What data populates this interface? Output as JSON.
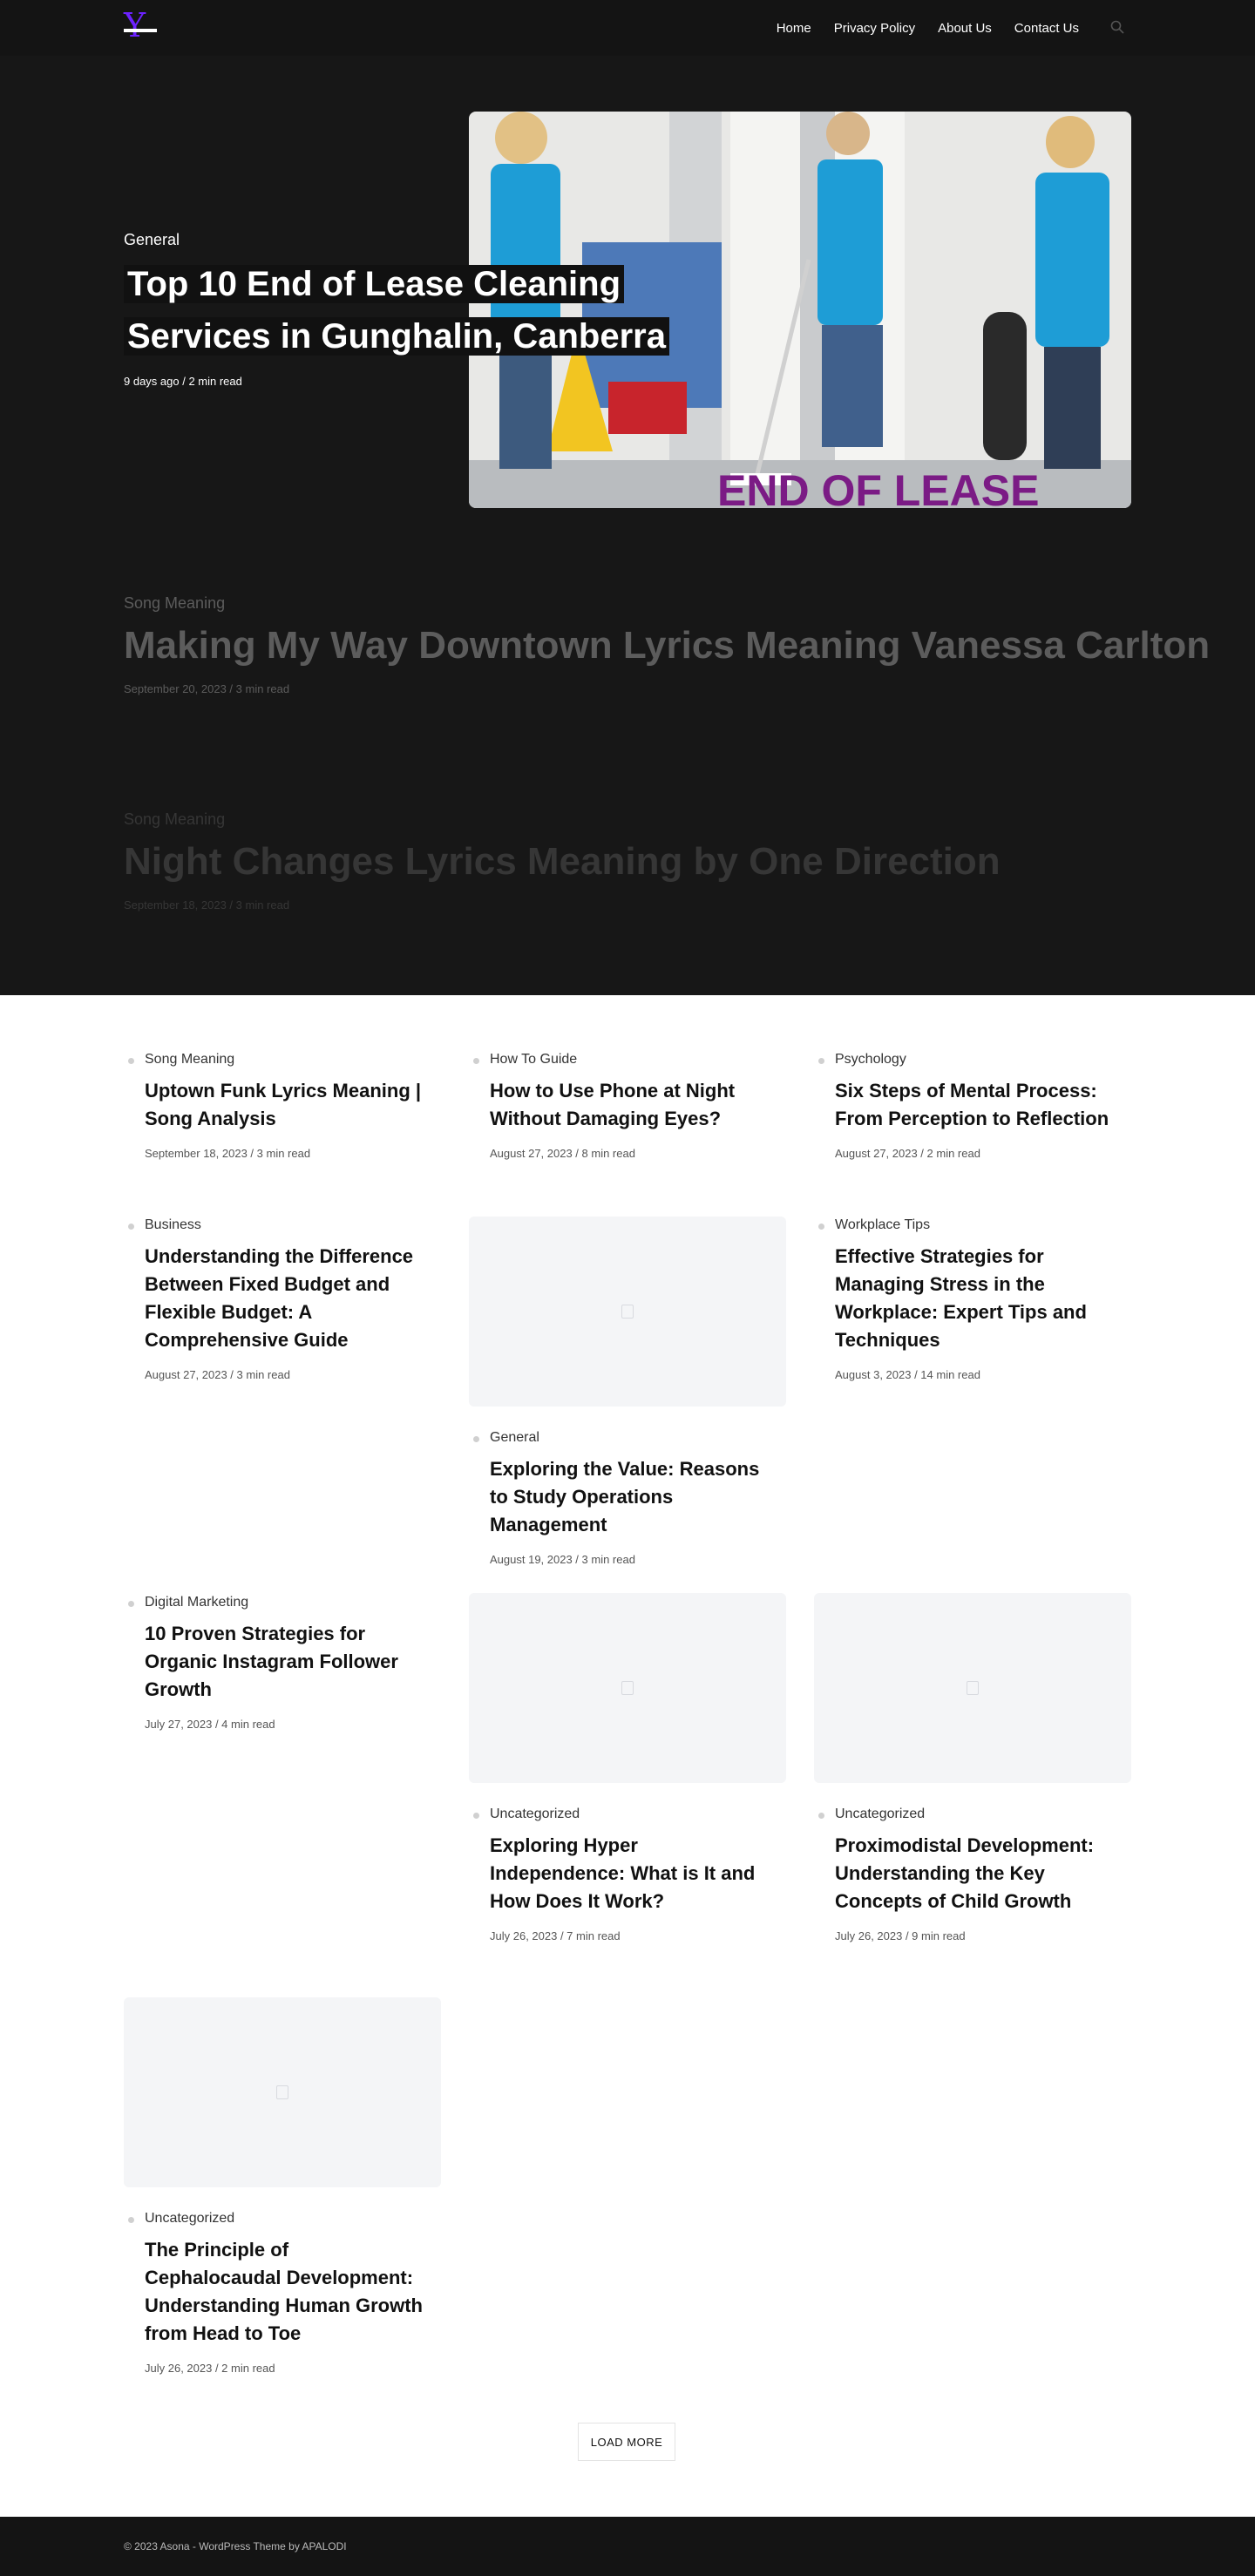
{
  "header": {
    "logo_letter": "Y",
    "nav": [
      "Home",
      "Privacy Policy",
      "About Us",
      "Contact Us"
    ]
  },
  "featured": {
    "category": "General",
    "title": "Top 10 End of Lease Cleaning Services in Gunghalin, Canberra",
    "meta": "9 days ago / 2 min read",
    "image_text": "END OF LEASE"
  },
  "hero_posts": [
    {
      "category": "Song Meaning",
      "title": "Making My Way Downtown Lyrics Meaning Vanessa Carlton",
      "meta": "September 20, 2023 / 3 min read"
    },
    {
      "category": "Song Meaning",
      "title": "Night Changes Lyrics Meaning by One Direction",
      "meta": "September 18, 2023 / 3 min read"
    }
  ],
  "posts": [
    {
      "category": "Song Meaning",
      "title": "Uptown Funk Lyrics Meaning | Song Analysis",
      "meta": "September 18, 2023 / 3 min read"
    },
    {
      "category": "How To Guide",
      "title": "How to Use Phone at Night Without Damaging Eyes?",
      "meta": "August 27, 2023 / 8 min read"
    },
    {
      "category": "Psychology",
      "title": "Six Steps of Mental Process: From Perception to Reflection",
      "meta": "August 27, 2023 / 2 min read"
    },
    {
      "category": "Business",
      "title": "Understanding the Difference Between Fixed Budget and Flexible Budget: A Comprehensive Guide",
      "meta": "August 27, 2023 / 3 min read"
    },
    {
      "category": "General",
      "title": "Exploring the Value: Reasons to Study Operations Management",
      "meta": "August 19, 2023 / 3 min read"
    },
    {
      "category": "Workplace Tips",
      "title": "Effective Strategies for Managing Stress in the Workplace: Expert Tips and Techniques",
      "meta": "August 3, 2023 / 14 min read"
    },
    {
      "category": "Digital Marketing",
      "title": "10 Proven Strategies for Organic Instagram Follower Growth",
      "meta": "July 27, 2023 / 4 min read"
    },
    {
      "category": "Uncategorized",
      "title": "Exploring Hyper Independence: What is It and How Does It Work?",
      "meta": "July 26, 2023 / 7 min read"
    },
    {
      "category": "Uncategorized",
      "title": "Proximodistal Development: Understanding the Key Concepts of Child Growth",
      "meta": "July 26, 2023 / 9 min read"
    },
    {
      "category": "Uncategorized",
      "title": "The Principle of Cephalocaudal Development: Understanding Human Growth from Head to Toe",
      "meta": "July 26, 2023 / 2 min read"
    }
  ],
  "load_more": "LOAD MORE",
  "footer": {
    "copyright": "© 2023 Asona - WordPress Theme by APALODI"
  }
}
